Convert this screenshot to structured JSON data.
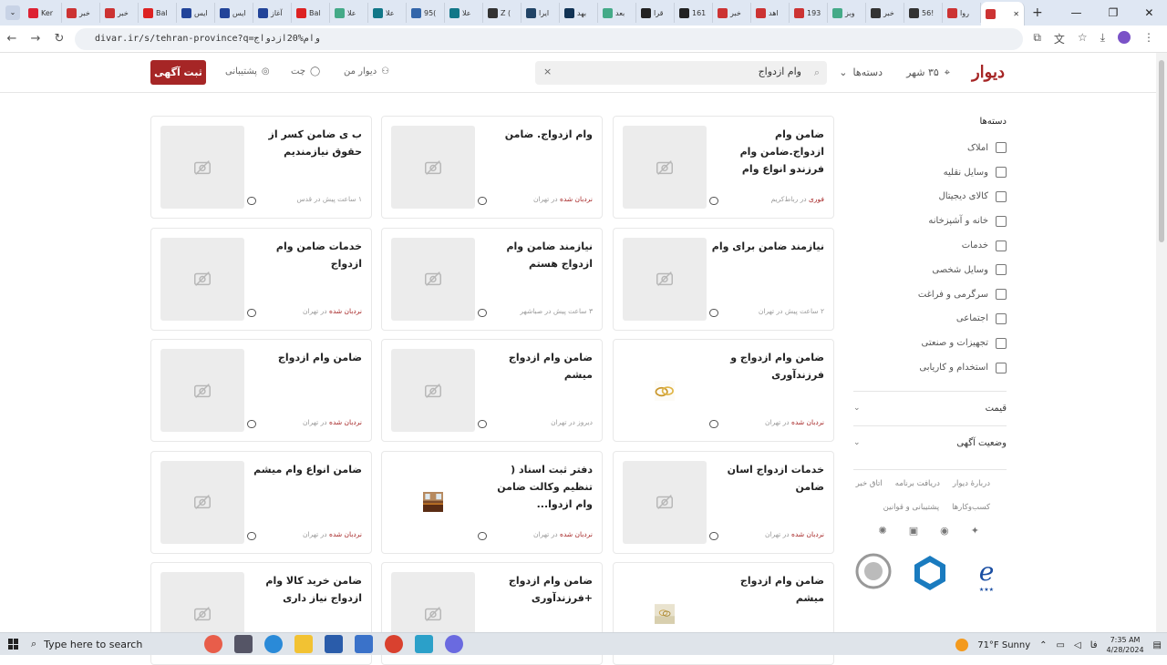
{
  "browser": {
    "tabs": [
      {
        "label": "Ker",
        "color": "#d23"
      },
      {
        "label": "خبر",
        "color": "#c33"
      },
      {
        "label": "خبر",
        "color": "#c33"
      },
      {
        "label": "Bal",
        "color": "#d22"
      },
      {
        "label": "ایس",
        "color": "#249"
      },
      {
        "label": "ایس",
        "color": "#249"
      },
      {
        "label": "آغاز",
        "color": "#249"
      },
      {
        "label": "Bal",
        "color": "#d22"
      },
      {
        "label": "علا",
        "color": "#4a8"
      },
      {
        "label": "علا",
        "color": "#178"
      },
      {
        "label": "95(",
        "color": "#36a"
      },
      {
        "label": "علا",
        "color": "#178"
      },
      {
        "label": "Z (",
        "color": "#333"
      },
      {
        "label": "ایرا",
        "color": "#246"
      },
      {
        "label": "بهد",
        "color": "#135"
      },
      {
        "label": "بعد",
        "color": "#4a8"
      },
      {
        "label": "قرا",
        "color": "#222"
      },
      {
        "label": "161",
        "color": "#222"
      },
      {
        "label": "خبر",
        "color": "#c33"
      },
      {
        "label": "اهد",
        "color": "#c33"
      },
      {
        "label": "193",
        "color": "#c33"
      },
      {
        "label": "وبز",
        "color": "#4a8"
      },
      {
        "label": "خبر",
        "color": "#333"
      },
      {
        "label": "56!",
        "color": "#333"
      },
      {
        "label": "روا",
        "color": "#c33"
      },
      {
        "label": "",
        "color": "#c33",
        "active": true
      }
    ],
    "url": "divar.ir/s/tehran-province?q=وام%20ازدواج"
  },
  "header": {
    "logo": "دیوار",
    "city": "۳۵ شهر",
    "categories": "دسته‌ها",
    "search_value": "وام ازدواج",
    "my_divar": "دیوار من",
    "chat": "چت",
    "support": "پشتیبانی",
    "post_button": "ثبت آگهی"
  },
  "sidebar": {
    "title": "دسته‌ها",
    "items": [
      {
        "label": "املاک",
        "icon": "building-icon"
      },
      {
        "label": "وسایل نقلیه",
        "icon": "car-icon"
      },
      {
        "label": "کالای دیجیتال",
        "icon": "phone-icon"
      },
      {
        "label": "خانه و آشپزخانه",
        "icon": "lamp-icon"
      },
      {
        "label": "خدمات",
        "icon": "brush-icon"
      },
      {
        "label": "وسایل شخصی",
        "icon": "watch-icon"
      },
      {
        "label": "سرگرمی و فراغت",
        "icon": "puzzle-icon"
      },
      {
        "label": "اجتماعی",
        "icon": "people-icon"
      },
      {
        "label": "تجهیزات و صنعتی",
        "icon": "microphone-icon"
      },
      {
        "label": "استخدام و کاریابی",
        "icon": "briefcase-icon"
      }
    ],
    "filter_price": "قیمت",
    "filter_status": "وضعیت آگهی",
    "footer_links": [
      "دربارهٔ دیوار",
      "دریافت برنامه",
      "اتاق خبر",
      "کسب‌وکارها",
      "پشتیبانی و قوانین"
    ]
  },
  "listings": [
    {
      "title": "ضامن وام ازدواج.ضامن وام فرزندو انواع وام",
      "meta_red": "فوری",
      "meta": "در رباط‌کریم",
      "image": "placeholder"
    },
    {
      "title": "وام ازدواج. ضامن",
      "meta_red": "نردبان شده",
      "meta": "در تهران",
      "image": "placeholder"
    },
    {
      "title": "ب ی ضامن کسر از حقوق نیازمندیم",
      "meta_red": "",
      "meta": "۱ ساعت پیش در قدس",
      "image": "placeholder"
    },
    {
      "title": "نیازمند ضامن برای وام",
      "meta_red": "",
      "meta": "۲ ساعت پیش در تهران",
      "image": "placeholder"
    },
    {
      "title": "نیازمند ضامن وام ازدواج هستم",
      "meta_red": "",
      "meta": "۳ ساعت پیش در صباشهر",
      "image": "placeholder"
    },
    {
      "title": "خدمات ضامن وام ازدواج",
      "meta_red": "نردبان شده",
      "meta": "در تهران",
      "image": "placeholder"
    },
    {
      "title": "ضامن وام ازدواج و فرزندآوری",
      "meta_red": "نردبان شده",
      "meta": "در تهران",
      "image": "rings"
    },
    {
      "title": "ضامن وام ازدواج میشم",
      "meta_red": "",
      "meta": "دیروز در تهران",
      "image": "placeholder"
    },
    {
      "title": "ضامن وام ازدواج",
      "meta_red": "نردبان شده",
      "meta": "در تهران",
      "image": "placeholder"
    },
    {
      "title": "خدمات ازدواج اسان ضامن",
      "meta_red": "نردبان شده",
      "meta": "در تهران",
      "image": "placeholder"
    },
    {
      "title": "دفتر ثبت اسناد ( تنظیم وکالت ضامن وام ازدوا...",
      "meta_red": "نردبان شده",
      "meta": "در تهران",
      "image": "office"
    },
    {
      "title": "ضامن انواع وام میشم",
      "meta_red": "نردبان شده",
      "meta": "در تهران",
      "image": "placeholder"
    },
    {
      "title": "ضامن وام ازدواج میشم",
      "meta_red": "",
      "meta": "",
      "image": "rings2"
    },
    {
      "title": "ضامن وام ازدواج +فرزندآوری",
      "meta_red": "",
      "meta": "",
      "image": "placeholder"
    },
    {
      "title": "ضامن خرید کالا وام ازدواج نیاز داری",
      "meta_red": "",
      "meta": "",
      "image": "placeholder"
    }
  ],
  "taskbar": {
    "search_placeholder": "Type here to search",
    "weather": "71°F  Sunny",
    "lang": "فا",
    "time": "7:35 AM",
    "date": "4/28/2024"
  },
  "colors": {
    "brand": "#a62626",
    "tabbar": "#dfe7f3"
  }
}
